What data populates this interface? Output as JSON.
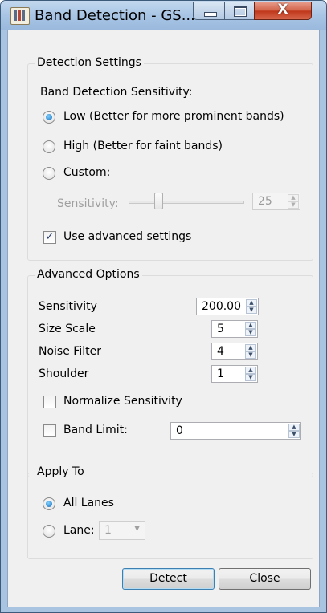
{
  "window": {
    "title": "Band Detection - GS..."
  },
  "titlebar_buttons": {
    "close_label": "X"
  },
  "detection_settings": {
    "group_title": "Detection Settings",
    "sensitivity_heading": "Band Detection Sensitivity:",
    "options": [
      {
        "label": "Low (Better for more prominent bands)",
        "selected": true
      },
      {
        "label": "High (Better for faint bands)",
        "selected": false
      },
      {
        "label": "Custom:",
        "selected": false
      }
    ],
    "custom_sensitivity_label": "Sensitivity:",
    "custom_sensitivity_value": "25",
    "use_advanced_label": "Use advanced settings",
    "use_advanced_checked": true
  },
  "advanced_options": {
    "group_title": "Advanced Options",
    "fields": [
      {
        "label": "Sensitivity",
        "value": "200.00"
      },
      {
        "label": "Size Scale",
        "value": "5"
      },
      {
        "label": "Noise Filter",
        "value": "4"
      },
      {
        "label": "Shoulder",
        "value": "1"
      }
    ],
    "normalize_label": "Normalize Sensitivity",
    "normalize_checked": false,
    "band_limit_label": "Band Limit:",
    "band_limit_checked": false,
    "band_limit_value": "0"
  },
  "apply_to": {
    "group_title": "Apply To",
    "all_lanes_label": "All Lanes",
    "all_lanes_selected": true,
    "lane_label": "Lane:",
    "lane_value": "1"
  },
  "buttons": {
    "detect": "Detect",
    "close": "Close"
  },
  "colors": {
    "title_bar": "#a9c4e1",
    "close_button": "#c0381c",
    "dialog_bg": "#f0f0f0",
    "radio_dot": "#1569b8"
  }
}
